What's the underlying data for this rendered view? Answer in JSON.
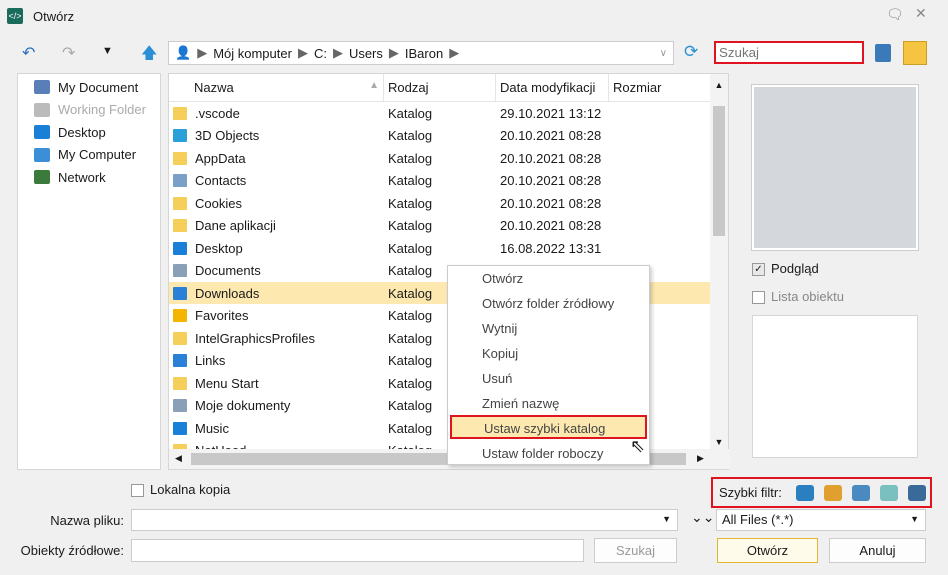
{
  "window": {
    "title": "Otwórz"
  },
  "address": {
    "segments": [
      "Mój komputer",
      "C:",
      "Users",
      "IBaron"
    ]
  },
  "search": {
    "placeholder": "Szukaj"
  },
  "sidebar": {
    "items": [
      {
        "label": "My Document",
        "color": "#5a7fb8",
        "disabled": false
      },
      {
        "label": "Working Folder",
        "color": "#bbbbbb",
        "disabled": true
      },
      {
        "label": "Desktop",
        "color": "#1a7fd6",
        "disabled": false
      },
      {
        "label": "My Computer",
        "color": "#3a8fd6",
        "disabled": false
      },
      {
        "label": "Network",
        "color": "#3a7a3a",
        "disabled": false
      }
    ]
  },
  "columns": [
    "Nazwa",
    "Rodzaj",
    "Data modyfikacji",
    "Rozmiar"
  ],
  "files": [
    {
      "name": ".vscode",
      "type": "Katalog",
      "date": "29.10.2021 13:12",
      "icon": "#f6cf5b"
    },
    {
      "name": "3D Objects",
      "type": "Katalog",
      "date": "20.10.2021 08:28",
      "icon": "#2aa0d8"
    },
    {
      "name": "AppData",
      "type": "Katalog",
      "date": "20.10.2021 08:28",
      "icon": "#f6cf5b"
    },
    {
      "name": "Contacts",
      "type": "Katalog",
      "date": "20.10.2021 08:28",
      "icon": "#7aa0c8"
    },
    {
      "name": "Cookies",
      "type": "Katalog",
      "date": "20.10.2021 08:28",
      "icon": "#f6cf5b"
    },
    {
      "name": "Dane aplikacji",
      "type": "Katalog",
      "date": "20.10.2021 08:28",
      "icon": "#f6cf5b"
    },
    {
      "name": "Desktop",
      "type": "Katalog",
      "date": "16.08.2022 13:31",
      "icon": "#1a7fd6"
    },
    {
      "name": "Documents",
      "type": "Katalog",
      "date": "",
      "icon": "#8aa0b8"
    },
    {
      "name": "Downloads",
      "type": "Katalog",
      "date": "",
      "icon": "#2a7fd6",
      "selected": true
    },
    {
      "name": "Favorites",
      "type": "Katalog",
      "date": "",
      "icon": "#f4b400"
    },
    {
      "name": "IntelGraphicsProfiles",
      "type": "Katalog",
      "date": "",
      "icon": "#f6cf5b"
    },
    {
      "name": "Links",
      "type": "Katalog",
      "date": "",
      "icon": "#2a7fd6"
    },
    {
      "name": "Menu Start",
      "type": "Katalog",
      "date": "",
      "icon": "#f6cf5b"
    },
    {
      "name": "Moje dokumenty",
      "type": "Katalog",
      "date": "",
      "icon": "#8aa0b8"
    },
    {
      "name": "Music",
      "type": "Katalog",
      "date": "",
      "icon": "#1a7fd6"
    },
    {
      "name": "NetHood",
      "type": "Katalog",
      "date": "",
      "icon": "#f6cf5b"
    }
  ],
  "context_menu": {
    "items": [
      "Otwórz",
      "Otwórz folder źródłowy",
      "Wytnij",
      "Kopiuj",
      "Usuń",
      "Zmień nazwę",
      "Ustaw szybki katalog",
      "Ustaw folder roboczy"
    ],
    "highlighted": 6
  },
  "preview": {
    "preview_label": "Podgląd",
    "preview_checked": true,
    "object_list_label": "Lista obiektu",
    "object_list_checked": false
  },
  "bottom": {
    "local_copy": "Lokalna kopia",
    "filename_label": "Nazwa pliku:",
    "filename_value": "",
    "source_label": "Obiekty źródłowe:",
    "source_value": "",
    "search_button": "Szukaj",
    "quick_filter_label": "Szybki filtr:",
    "file_type": "All Files (*.*)",
    "open_button": "Otwórz",
    "cancel_button": "Anuluj"
  }
}
